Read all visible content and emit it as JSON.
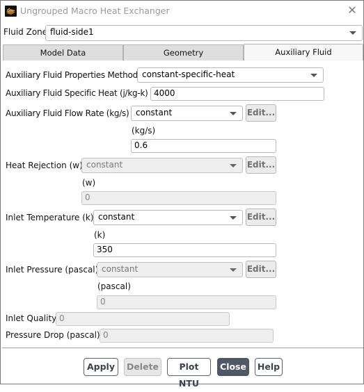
{
  "window": {
    "title": "Ungrouped Macro Heat Exchanger",
    "icon": "fluent-app-icon",
    "close_icon": "close-icon"
  },
  "fluid_zone": {
    "label": "Fluid Zone",
    "value": "fluid-side1"
  },
  "tabs": [
    {
      "label": "Model Data",
      "active": false
    },
    {
      "label": "Geometry",
      "active": false
    },
    {
      "label": "Auxiliary Fluid",
      "active": true
    }
  ],
  "form": {
    "properties_method": {
      "label": "Auxiliary Fluid Properties Method",
      "value": "constant-specific-heat"
    },
    "specific_heat": {
      "label": "Auxiliary Fluid Specific Heat (j/kg-k)",
      "value": "4000"
    },
    "flow_rate": {
      "label": "Auxiliary Fluid Flow Rate (kg/s)",
      "method": "constant",
      "edit": "Edit...",
      "unit": "(kg/s)",
      "value": "0.6",
      "enabled": true
    },
    "heat_rejection": {
      "label": "Heat Rejection (w)",
      "method": "constant",
      "edit": "Edit...",
      "unit": "(w)",
      "value": "0",
      "enabled": false
    },
    "inlet_temperature": {
      "label": "Inlet Temperature (k)",
      "method": "constant",
      "edit": "Edit...",
      "unit": "(k)",
      "value": "350",
      "enabled": true
    },
    "inlet_pressure": {
      "label": "Inlet Pressure (pascal)",
      "method": "constant",
      "edit": "Edit...",
      "unit": "(pascal)",
      "value": "0",
      "enabled": false
    },
    "inlet_quality": {
      "label": "Inlet Quality",
      "value": "0",
      "enabled": false
    },
    "pressure_drop": {
      "label": "Pressure Drop (pascal)",
      "value": "0",
      "enabled": false
    }
  },
  "buttons": {
    "apply": "Apply",
    "delete": "Delete",
    "plot_ntu": "Plot NTU",
    "close": "Close",
    "help": "Help"
  },
  "colors": {
    "primary_button": "#4e5866",
    "disabled_field": "#eeeeee"
  }
}
